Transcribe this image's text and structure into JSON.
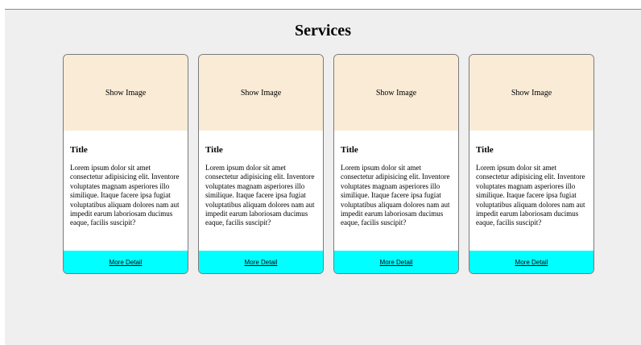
{
  "page": {
    "heading": "Services"
  },
  "colors": {
    "background": "#efefef",
    "image_placeholder": "#faebd7",
    "footer": "#00ffff",
    "card": "#ffffff"
  },
  "cards": [
    {
      "image_label": "Show Image",
      "title": "Title",
      "text": "Lorem ipsum dolor sit amet consectetur adipisicing elit. Inventore voluptates magnam asperiores illo similique. Itaque facere ipsa fugiat voluptatibus aliquam dolores nam aut impedit earum laboriosam ducimus eaque, facilis suscipit?",
      "link_label": "More Detail"
    },
    {
      "image_label": "Show Image",
      "title": "Title",
      "text": "Lorem ipsum dolor sit amet consectetur adipisicing elit. Inventore voluptates magnam asperiores illo similique. Itaque facere ipsa fugiat voluptatibus aliquam dolores nam aut impedit earum laboriosam ducimus eaque, facilis suscipit?",
      "link_label": "More Detail"
    },
    {
      "image_label": "Show Image",
      "title": "Title",
      "text": "Lorem ipsum dolor sit amet consectetur adipisicing elit. Inventore voluptates magnam asperiores illo similique. Itaque facere ipsa fugiat voluptatibus aliquam dolores nam aut impedit earum laboriosam ducimus eaque, facilis suscipit?",
      "link_label": "More Detail"
    },
    {
      "image_label": "Show Image",
      "title": "Title",
      "text": "Lorem ipsum dolor sit amet consectetur adipisicing elit. Inventore voluptates magnam asperiores illo similique. Itaque facere ipsa fugiat voluptatibus aliquam dolores nam aut impedit earum laboriosam ducimus eaque, facilis suscipit?",
      "link_label": "More Detail"
    }
  ]
}
